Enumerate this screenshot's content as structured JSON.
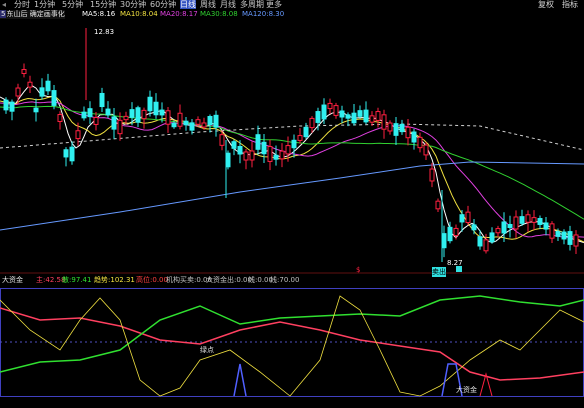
{
  "toolbar": {
    "timeframes": [
      "分时",
      "1分钟",
      "5分钟",
      "15分钟",
      "30分钟",
      "60分钟",
      "日线",
      "周线",
      "月线",
      "多周期",
      "更多"
    ],
    "selected_index": 6,
    "buttons": [
      "复权",
      "指标"
    ]
  },
  "symbol": {
    "badge": "5",
    "title": "东山后 确定画事化"
  },
  "ma_legend": [
    {
      "label": "MA5:",
      "value": "8.16",
      "color": "#ffffff"
    },
    {
      "label": "MA10:",
      "value": "8.04",
      "color": "#f0e040"
    },
    {
      "label": "MA20:",
      "value": "8.17",
      "color": "#e040e0"
    },
    {
      "label": "MA30:",
      "value": "8.08",
      "color": "#30d030"
    },
    {
      "label": "MA120:",
      "value": "8.30",
      "color": "#6699ff"
    }
  ],
  "price_labels": {
    "high": "12.83",
    "low": "8.27"
  },
  "sell_marker": "卖出",
  "indicator": {
    "name": "大资金",
    "values": [
      {
        "label": "主:",
        "value": "42.58",
        "color": "#ff4060"
      },
      {
        "label": "散:",
        "value": "97.41",
        "color": "#30e030"
      },
      {
        "label": "趋势:",
        "value": "102.31",
        "color": "#f0e040"
      },
      {
        "label": "高位:",
        "value": "0.00",
        "color": "#ff4040"
      },
      {
        "label": "机构买卖:",
        "value": "0.00",
        "color": "#c0c0c0"
      },
      {
        "label": "大资金出:",
        "value": "0.00",
        "color": "#c0c0c0"
      },
      {
        "label": "线:",
        "value": "0.00",
        "color": "#c0c0c0"
      },
      {
        "label": "线:",
        "value": "70.00",
        "color": "#c0c0c0"
      }
    ],
    "annotations": [
      "绿点",
      "大资金"
    ]
  },
  "colors": {
    "up": "#ff2040",
    "down": "#30f0f0"
  }
}
